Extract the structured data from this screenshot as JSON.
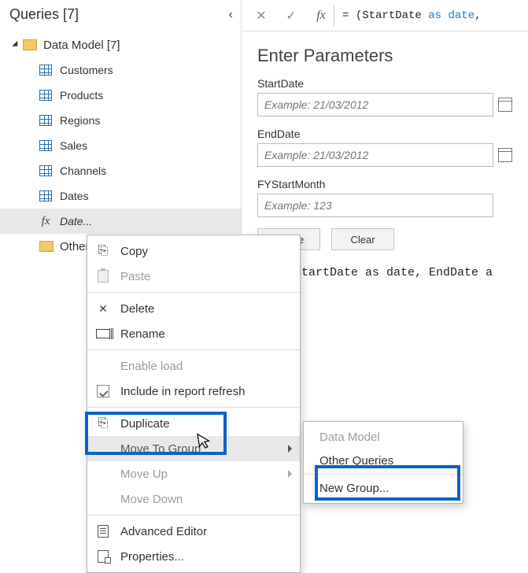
{
  "queries_panel": {
    "title": "Queries [7]",
    "folder_label": "Data Model [7]",
    "items": {
      "customers": "Customers",
      "products": "Products",
      "regions": "Regions",
      "sales": "Sales",
      "channels": "Channels",
      "dates": "Dates",
      "date_fn": "Date...",
      "other": "Other"
    }
  },
  "formula_bar": {
    "eq": "=",
    "open": "(",
    "ident1": "StartDate",
    "kw_as": "as",
    "kw_date": "date",
    "tail": ","
  },
  "params": {
    "title": "Enter Parameters",
    "start_label": "StartDate",
    "start_placeholder": "Example: 21/03/2012",
    "end_label": "EndDate",
    "end_placeholder": "Example: 21/03/2012",
    "fy_label": "FYStartMonth",
    "fy_placeholder": "Example: 123",
    "invoke": "Invoke",
    "clear": "Clear"
  },
  "snippet": {
    "text": "ion (StartDate as date, EndDate a"
  },
  "context_menu": {
    "copy": "Copy",
    "paste": "Paste",
    "delete": "Delete",
    "rename": "Rename",
    "enable_load": "Enable load",
    "include_refresh": "Include in report refresh",
    "duplicate": "Duplicate",
    "move_to_group": "Move To Group",
    "move_up": "Move Up",
    "move_down": "Move Down",
    "advanced_editor": "Advanced Editor",
    "properties": "Properties..."
  },
  "submenu": {
    "data_model": "Data Model",
    "other_queries": "Other Queries",
    "new_group": "New Group..."
  }
}
